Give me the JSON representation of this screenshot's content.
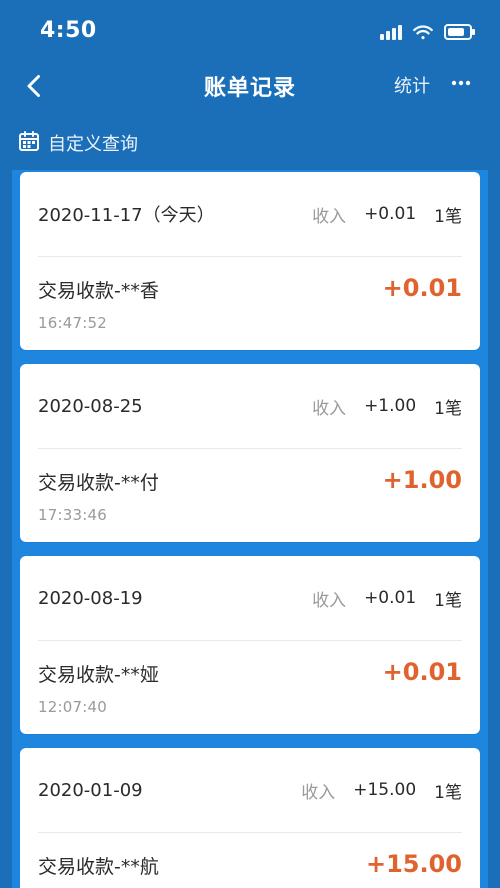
{
  "status_bar": {
    "time": "4:50"
  },
  "header": {
    "title": "账单记录",
    "stats_label": "统计"
  },
  "custom_query": {
    "label": "自定义查询"
  },
  "records": [
    {
      "date": "2020-11-17（今天）",
      "income_label": "收入",
      "income_amount": "+0.01",
      "count_label": "1笔",
      "tx_title": "交易收款-**香",
      "tx_time": "16:47:52",
      "tx_amount": "+0.01"
    },
    {
      "date": "2020-08-25",
      "income_label": "收入",
      "income_amount": "+1.00",
      "count_label": "1笔",
      "tx_title": "交易收款-**付",
      "tx_time": "17:33:46",
      "tx_amount": "+1.00"
    },
    {
      "date": "2020-08-19",
      "income_label": "收入",
      "income_amount": "+0.01",
      "count_label": "1笔",
      "tx_title": "交易收款-**娅",
      "tx_time": "12:07:40",
      "tx_amount": "+0.01"
    },
    {
      "date": "2020-01-09",
      "income_label": "收入",
      "income_amount": "+15.00",
      "count_label": "1笔",
      "tx_title": "交易收款-**航",
      "tx_time": "",
      "tx_amount": "+15.00"
    }
  ],
  "icons": {
    "back": "chevron-left-icon",
    "more": "more-dots-icon",
    "calendar": "calendar-icon",
    "wifi": "wifi-icon",
    "battery": "battery-icon",
    "signal": "signal-icon"
  },
  "colors": {
    "header_bg": "#1a6fb8",
    "content_bg": "#1f86e0",
    "amount": "#e0622f"
  }
}
